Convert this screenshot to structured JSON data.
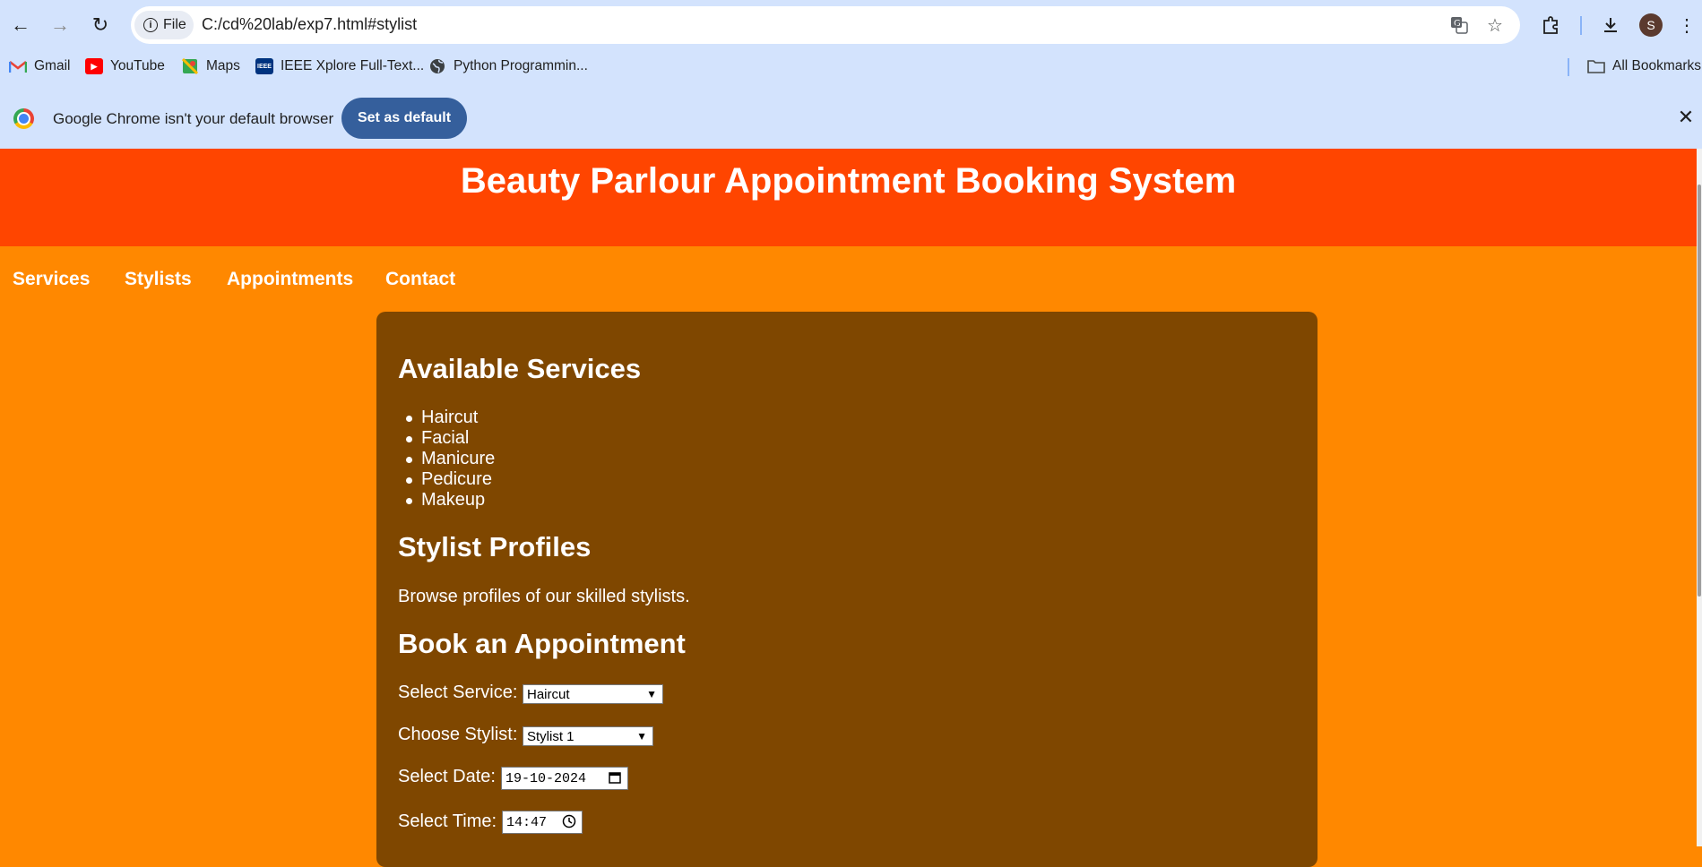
{
  "browser": {
    "url": "C:/cd%20lab/exp7.html#stylist",
    "site_chip_label": "File",
    "avatar_letter": "S",
    "bookmarks": [
      {
        "label": "Gmail",
        "icon": "gmail-icon"
      },
      {
        "label": "YouTube",
        "icon": "youtube-icon"
      },
      {
        "label": "Maps",
        "icon": "maps-icon"
      },
      {
        "label": "IEEE Xplore Full-Text...",
        "icon": "ieee-icon"
      },
      {
        "label": "Python Programmin...",
        "icon": "globe-icon"
      }
    ],
    "all_bookmarks_label": "All Bookmarks",
    "infobar": {
      "message": "Google Chrome isn't your default browser",
      "button_label": "Set as default"
    }
  },
  "page": {
    "title": "Beauty Parlour Appointment Booking System",
    "nav": [
      "Services",
      "Stylists",
      "Appointments",
      "Contact"
    ],
    "services_heading": "Available Services",
    "services": [
      "Haircut",
      "Facial",
      "Manicure",
      "Pedicure",
      "Makeup"
    ],
    "stylists_heading": "Stylist Profiles",
    "stylists_text": "Browse profiles of our skilled stylists.",
    "booking_heading": "Book an Appointment",
    "form": {
      "service_label": "Select Service:",
      "service_value": "Haircut",
      "stylist_label": "Choose Stylist:",
      "stylist_value": "Stylist 1",
      "date_label": "Select Date:",
      "date_value": "19-10-2024",
      "time_label": "Select Time:",
      "time_value": "14:47"
    }
  },
  "colors": {
    "header": "#ff4500",
    "page_bg": "#ff8800",
    "main_bg": "#7f4700",
    "chrome_bg": "#d3e3fd"
  }
}
